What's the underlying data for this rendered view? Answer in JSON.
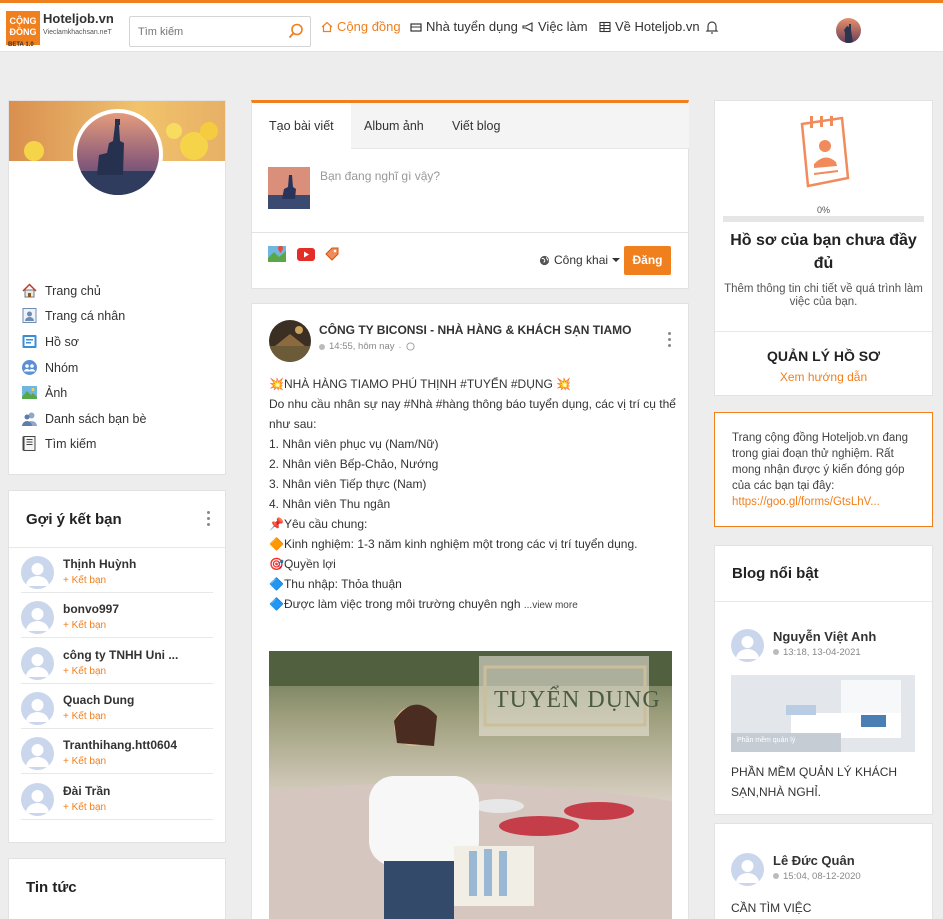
{
  "header": {
    "logo": {
      "box_text": "CỘNG ĐỒNG",
      "name": "Hoteljob.vn",
      "subtitle": "Vieclamkhachsan.neT",
      "beta": "BETA 1.0"
    },
    "search_placeholder": "Tìm kiếm",
    "nav": [
      {
        "label": "Cộng đồng",
        "icon": "home-icon",
        "active": true
      },
      {
        "label": "Nhà tuyển dụng",
        "icon": "building-icon"
      },
      {
        "label": "Việc làm",
        "icon": "megaphone-icon"
      },
      {
        "label": "Về Hoteljob.vn",
        "icon": "grid-icon"
      }
    ],
    "accent_color": "#f07f1d"
  },
  "left_profile": {
    "menu": [
      {
        "label": "Trang chủ",
        "icon": "home-icon"
      },
      {
        "label": "Trang cá nhân",
        "icon": "profile-icon"
      },
      {
        "label": "Hồ sơ",
        "icon": "resume-icon"
      },
      {
        "label": "Nhóm",
        "icon": "group-icon"
      },
      {
        "label": "Ảnh",
        "icon": "photo-icon"
      },
      {
        "label": "Danh sách bạn bè",
        "icon": "friends-icon"
      },
      {
        "label": "Tìm kiếm",
        "icon": "search-book-icon"
      }
    ]
  },
  "friend_suggestions": {
    "title": "Gợi ý kết bạn",
    "add_label": "Kết bạn",
    "items": [
      {
        "name": "Thịnh Huỳnh"
      },
      {
        "name": "bonvo997"
      },
      {
        "name": "công ty TNHH Uni ..."
      },
      {
        "name": "Quach Dung"
      },
      {
        "name": "Tranthihang.htt0604"
      },
      {
        "name": "Đài Trần"
      }
    ]
  },
  "news": {
    "title": "Tin tức"
  },
  "composer": {
    "tabs": [
      "Tạo bài viết",
      "Album ảnh",
      "Viết blog"
    ],
    "placeholder": "Bạn đang nghĩ gì vậy?",
    "privacy": "Công khai",
    "post_button": "Đăng"
  },
  "post": {
    "author": "CÔNG TY BICONSI - NHÀ HÀNG & KHÁCH SẠN TIAMO",
    "time": "14:55, hôm nay",
    "lines": [
      "💥NHÀ HÀNG TIAMO PHÚ THỊNH #TUYỂN #DỤNG 💥",
      "Do nhu cầu nhân sự nay #Nhà #hàng thông báo tuyển dụng, các vị trí cụ thể",
      "như sau:",
      "1. Nhân viên phục vụ (Nam/Nữ)",
      "2. Nhân viên Bếp-Chảo, Nướng",
      "3. Nhân viên Tiếp thực (Nam)",
      "4. Nhân viên Thu ngân",
      "📌Yêu cầu chung:",
      "🔶Kinh nghiệm: 1-3 năm kinh nghiệm một trong các vị trí tuyển dụng.",
      "🎯Quyền lợi",
      "🔷Thu nhập: Thỏa thuận"
    ],
    "last_line": "🔷Được làm việc trong môi trường chuyên ngh",
    "view_more": "...view more",
    "image_banner": "TUYỂN DỤNG"
  },
  "profile_status": {
    "progress_percent": 0,
    "progress_label": "0%",
    "title": "Hồ sơ của bạn chưa đầy đủ",
    "desc": "Thêm thông tin chi tiết về quá trình làm việc của bạn.",
    "manage_title": "QUẢN LÝ HỒ SƠ",
    "manage_link": "Xem hướng dẫn"
  },
  "notice": {
    "text": "Trang cộng đồng Hoteljob.vn đang trong giai đoạn thử nghiệm. Rất mong nhận được ý kiến đóng góp của các bạn tại đây:",
    "link": "https://goo.gl/forms/GtsLhV..."
  },
  "blogs": {
    "title": "Blog nổi bật",
    "items": [
      {
        "author": "Nguyễn Việt Anh",
        "time": "13:18, 13-04-2021",
        "title": "PHẦN MỀM QUẢN LÝ KHÁCH SẠN,NHÀ NGHỈ.",
        "image_caption": "Phần mềm quản lý"
      },
      {
        "author": "Lê Đức Quân",
        "time": "15:04, 08-12-2020",
        "title": "CẦN TÌM VIỆC"
      }
    ]
  }
}
